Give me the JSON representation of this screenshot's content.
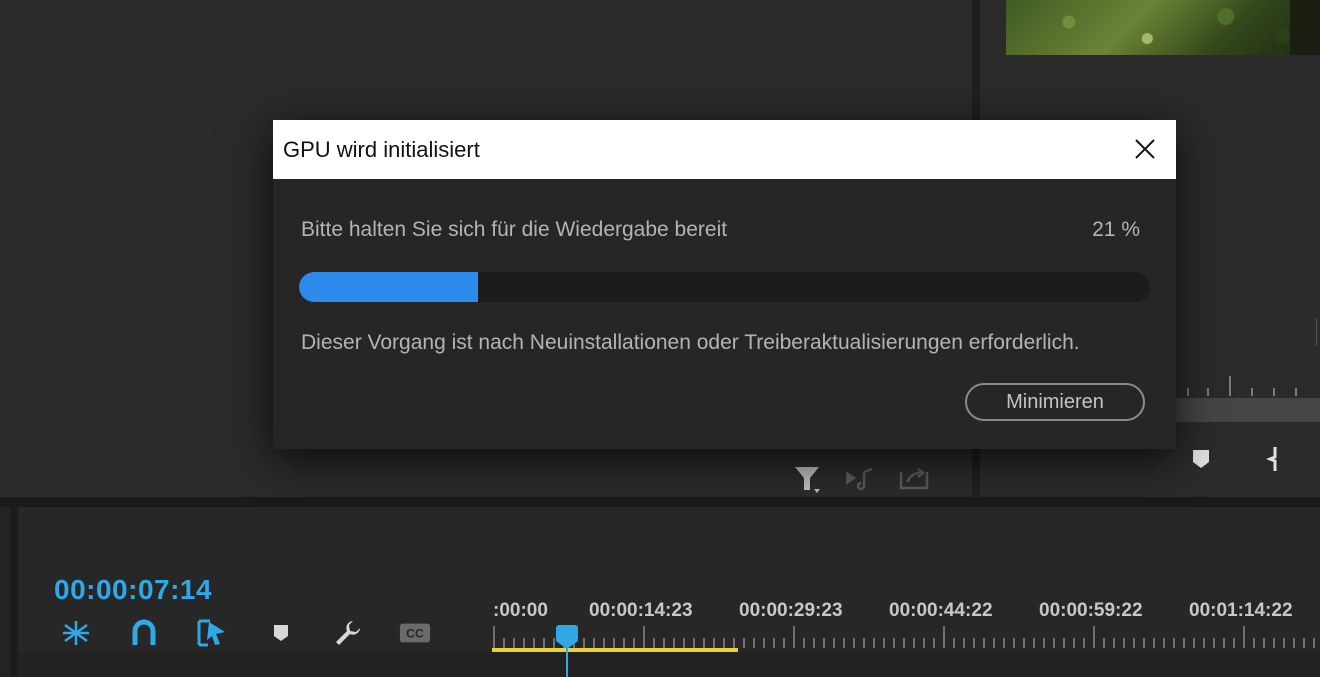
{
  "dialog": {
    "title": "GPU wird initialisiert",
    "status": "Bitte halten Sie sich für die Wiedergabe bereit",
    "percent_label": "21 %",
    "progress": 0.21,
    "info": "Dieser Vorgang ist nach Neuinstallationen oder Treiberaktualisierungen erforderlich.",
    "minimize_label": "Minimieren",
    "close_icon": "close-icon"
  },
  "timeline": {
    "current_timecode": "00:00:07:14",
    "ruler_labels": [
      ":00:00",
      "00:00:14:23",
      "00:00:29:23",
      "00:00:44:22",
      "00:00:59:22",
      "00:01:14:22"
    ],
    "tools": [
      "snap-icon",
      "magnet-icon",
      "linked-selection-icon",
      "marker-icon",
      "wrench-icon",
      "cc-icon"
    ]
  },
  "colors": {
    "accent": "#2fa8e6",
    "progress": "#2d8ceb",
    "work_area": "#e8d23a"
  }
}
